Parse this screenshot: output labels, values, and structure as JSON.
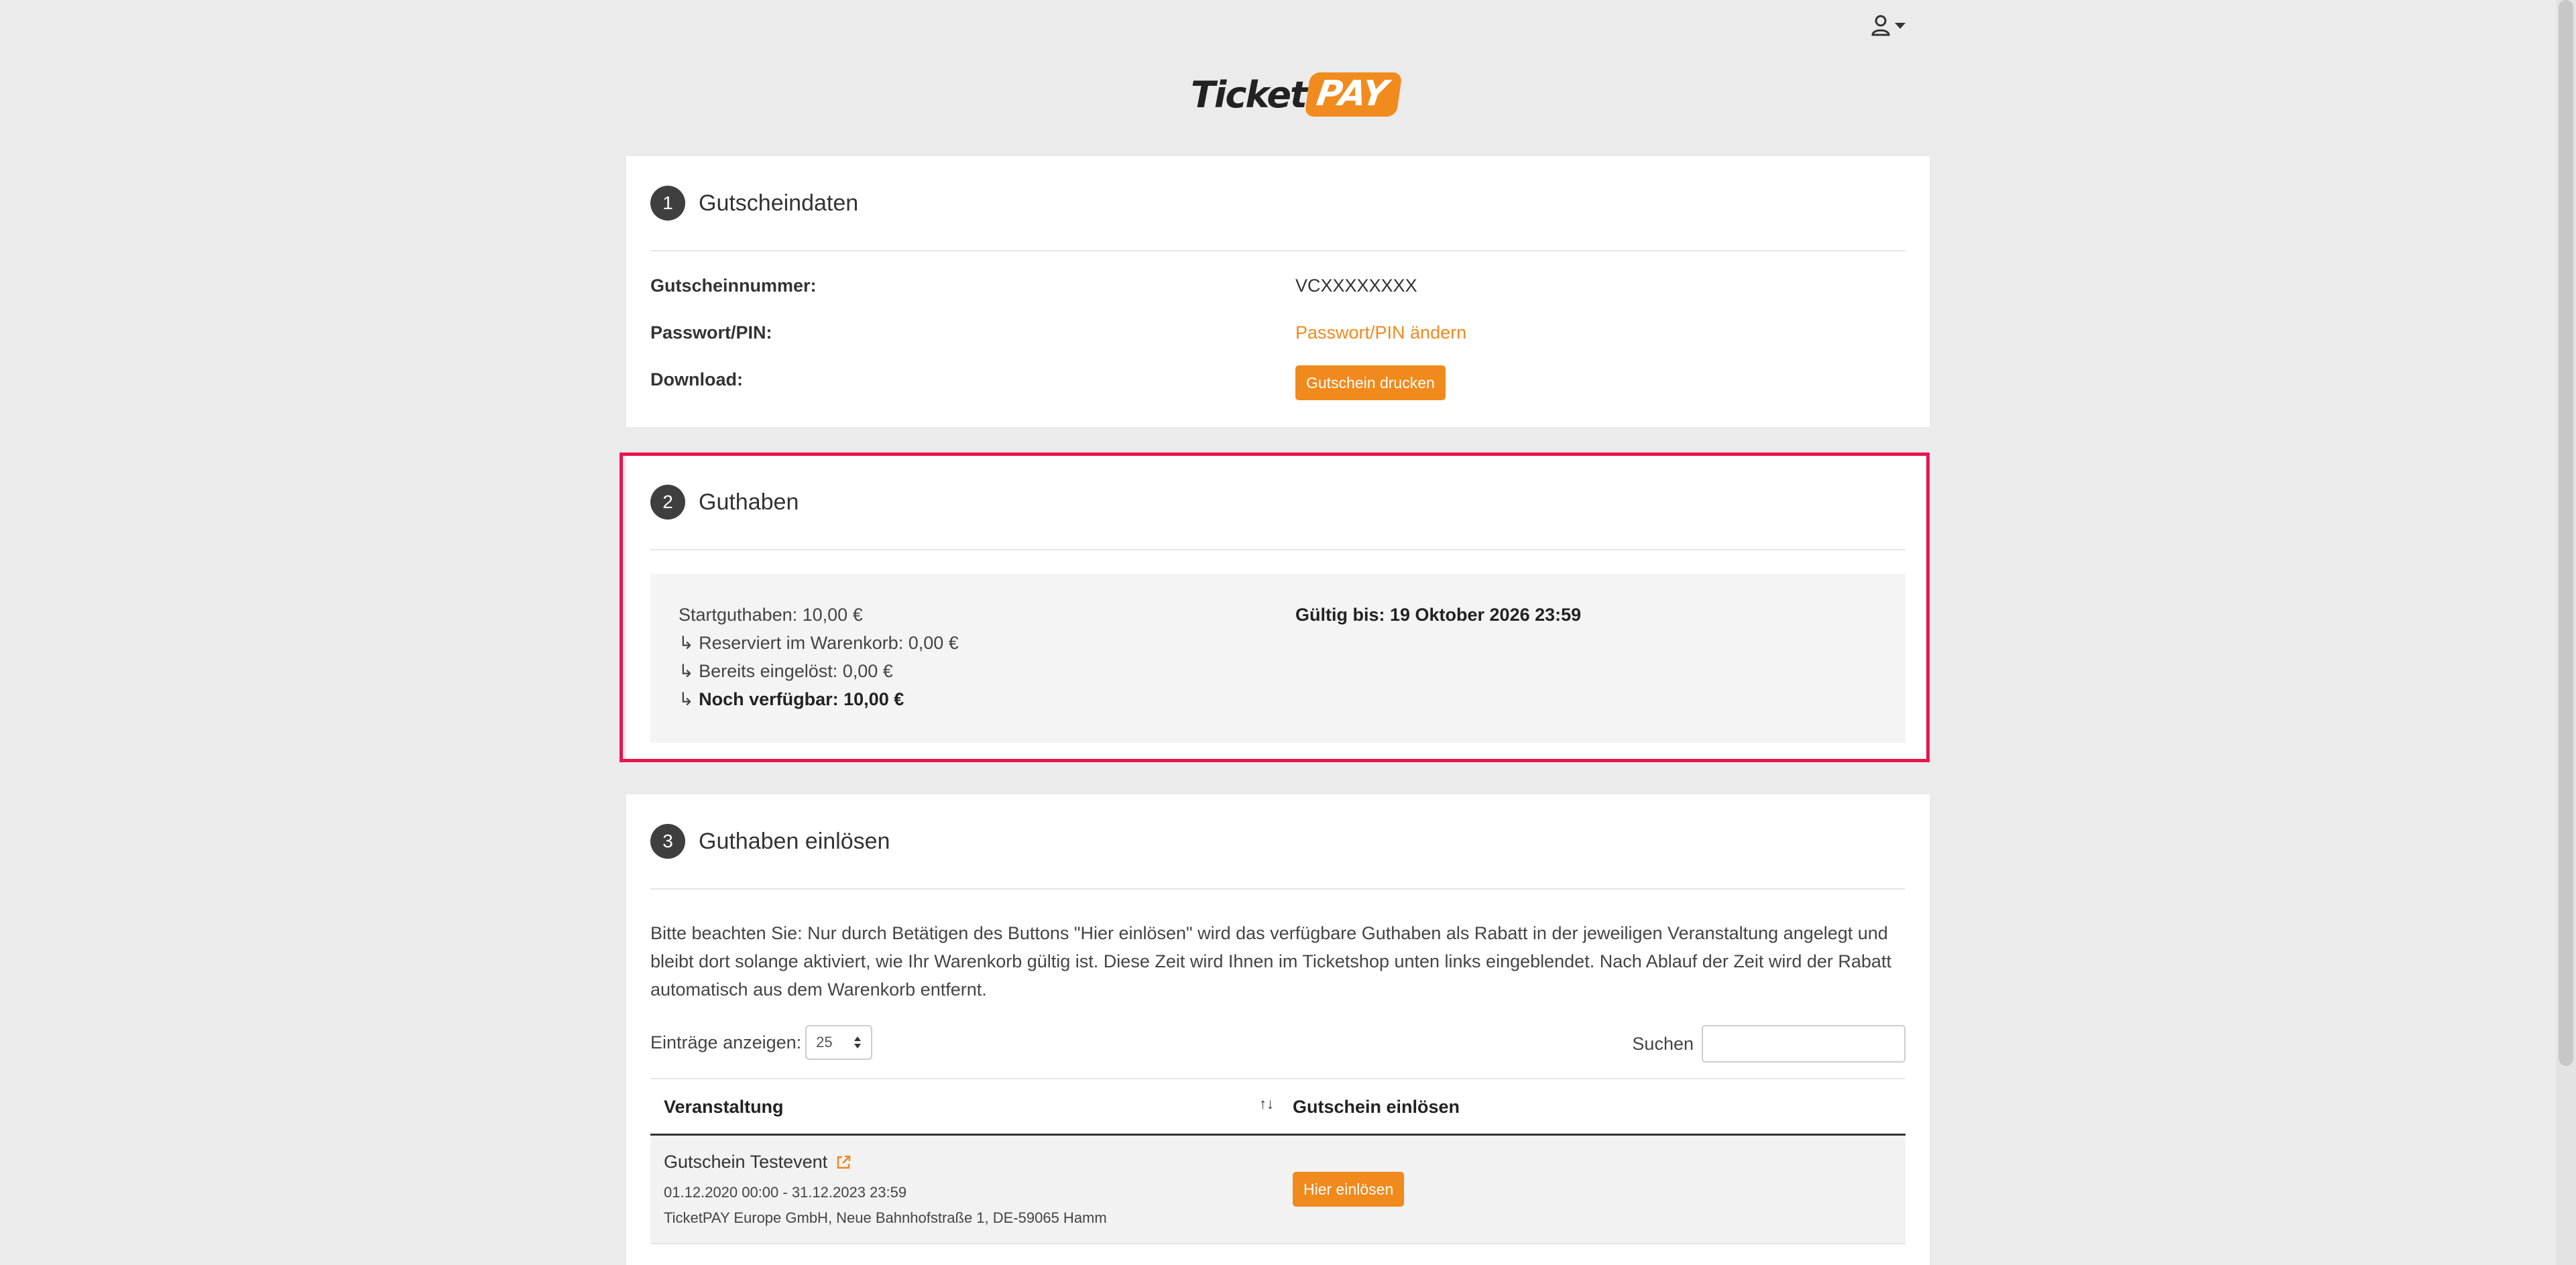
{
  "colors": {
    "accent": "#f08a1c",
    "highlight": "#e8154f",
    "step_badge": "#3f3f3f"
  },
  "header": {
    "user_icon": "user-icon",
    "logo": {
      "ticket": "Ticket",
      "pay": "PAY"
    }
  },
  "section1": {
    "step": "1",
    "title": "Gutscheindaten",
    "rows": {
      "voucher_label": "Gutscheinnummer:",
      "voucher_value": "VCXXXXXXXX",
      "pin_label": "Passwort/PIN:",
      "pin_link": "Passwort/PIN ändern",
      "download_label": "Download:",
      "download_button": "Gutschein drucken"
    }
  },
  "section2": {
    "step": "2",
    "title": "Guthaben",
    "start": "Startguthaben: 10,00 €",
    "reserved": "↳ Reserviert im Warenkorb: 0,00 €",
    "redeemed": "↳ Bereits eingelöst: 0,00 €",
    "available_prefix": "↳ ",
    "available": "Noch verfügbar: 10,00 €",
    "valid_until": "Gültig bis: 19 Oktober 2026 23:59"
  },
  "section3": {
    "step": "3",
    "title": "Guthaben einlösen",
    "notice": "Bitte beachten Sie: Nur durch Betätigen des Buttons \"Hier einlösen\" wird das verfügbare Guthaben als Rabatt in der jeweiligen Veranstaltung angelegt und bleibt dort solange aktiviert, wie Ihr Warenkorb gültig ist. Diese Zeit wird Ihnen im Ticketshop unten links eingeblendet. Nach Ablauf der Zeit wird der Rabatt automatisch aus dem Warenkorb entfernt.",
    "entries_label": "Einträge anzeigen:",
    "entries_value": "25",
    "search_label": "Suchen",
    "search_value": "",
    "columns": [
      "Veranstaltung",
      "Gutschein einlösen"
    ],
    "rows": [
      {
        "event": "Gutschein Testevent",
        "date": "01.12.2020 00:00 - 31.12.2023 23:59",
        "address": "TicketPAY Europe GmbH, Neue Bahnhofstraße 1, DE-59065 Hamm",
        "button": "Hier einlösen"
      }
    ]
  }
}
